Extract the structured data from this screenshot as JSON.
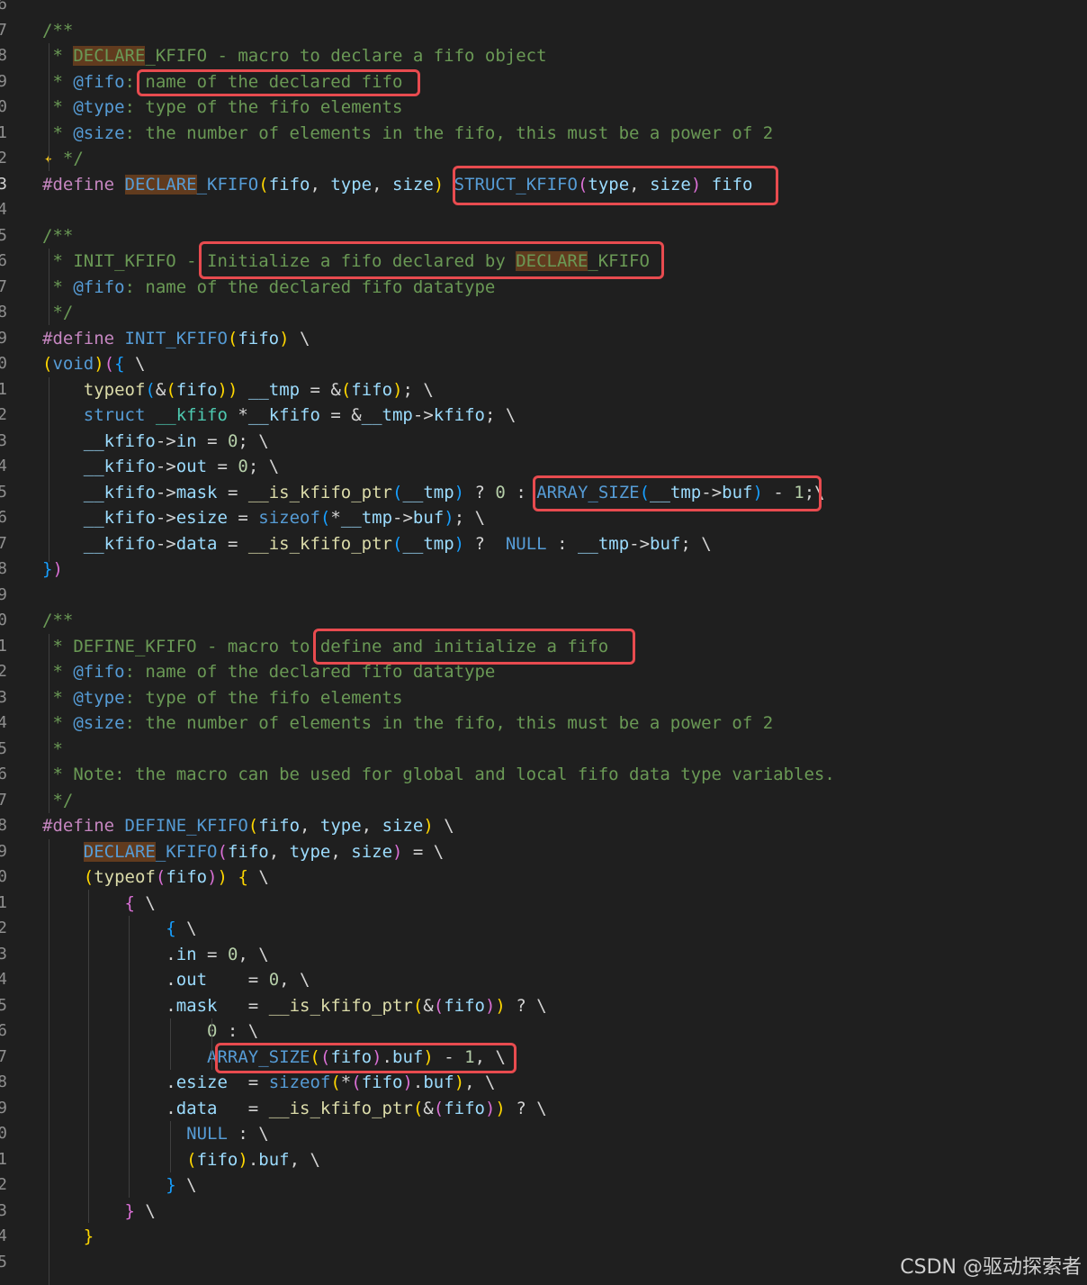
{
  "gutter": [
    "6",
    "7",
    "8",
    "9",
    "0",
    "1",
    "2",
    "3",
    "4",
    "5",
    "6",
    "7",
    "8",
    "9",
    "0",
    "1",
    "2",
    "3",
    "4",
    "5",
    "6",
    "7",
    "8",
    "9",
    "0",
    "1",
    "2",
    "3",
    "4",
    "5",
    "6",
    "7",
    "8",
    "9",
    "0",
    "1",
    "2",
    "3",
    "4",
    "5",
    "6",
    "7",
    "8",
    "9",
    "0",
    "1",
    "2",
    "3",
    "4",
    "5"
  ],
  "active_line": 7,
  "lines": [
    [],
    [
      [
        "c",
        "/**"
      ]
    ],
    [
      [
        "c",
        " * "
      ],
      [
        "cbg",
        "DECLARE"
      ],
      [
        "c",
        "_KFIFO - macro to declare a fifo object"
      ]
    ],
    [
      [
        "c",
        " * "
      ],
      [
        "cdoc",
        "@fifo"
      ],
      [
        "c",
        ": name of the declared fifo"
      ]
    ],
    [
      [
        "c",
        " * "
      ],
      [
        "cdoc",
        "@type"
      ],
      [
        "c",
        ": type of the fifo elements"
      ]
    ],
    [
      [
        "c",
        " * "
      ],
      [
        "cdoc",
        "@size"
      ],
      [
        "c",
        ": the number of elements in the fifo, this must be a power of 2"
      ]
    ],
    [
      [
        "c",
        "  */"
      ]
    ],
    [
      [
        "pp",
        "#define "
      ],
      [
        "mbg",
        "DECLARE"
      ],
      [
        "m",
        "_KFIFO"
      ],
      [
        "y",
        "("
      ],
      [
        "p",
        "fifo"
      ],
      [
        "t",
        ", "
      ],
      [
        "p",
        "type"
      ],
      [
        "t",
        ", "
      ],
      [
        "p",
        "size"
      ],
      [
        "y",
        ")"
      ],
      [
        "t",
        " "
      ],
      [
        "m",
        "STRUCT_KFIFO"
      ],
      [
        "pk",
        "("
      ],
      [
        "p",
        "type"
      ],
      [
        "t",
        ", "
      ],
      [
        "p",
        "size"
      ],
      [
        "pk",
        ")"
      ],
      [
        "t",
        " "
      ],
      [
        "p",
        "fifo"
      ]
    ],
    [],
    [
      [
        "c",
        "/**"
      ]
    ],
    [
      [
        "c",
        " * INIT_KFIFO - Initialize a fifo declared by "
      ],
      [
        "cbg",
        "DECLARE"
      ],
      [
        "c",
        "_KFIFO"
      ]
    ],
    [
      [
        "c",
        " * "
      ],
      [
        "cdoc",
        "@fifo"
      ],
      [
        "c",
        ": name of the declared fifo datatype"
      ]
    ],
    [
      [
        "c",
        " */"
      ]
    ],
    [
      [
        "pp",
        "#define "
      ],
      [
        "m",
        "INIT_KFIFO"
      ],
      [
        "y",
        "("
      ],
      [
        "p",
        "fifo"
      ],
      [
        "y",
        ")"
      ],
      [
        "t",
        " \\"
      ]
    ],
    [
      [
        "y",
        "("
      ],
      [
        "k",
        "void"
      ],
      [
        "y",
        ")"
      ],
      [
        "pk",
        "("
      ],
      [
        "bl",
        "{"
      ],
      [
        "t",
        " \\"
      ]
    ],
    [
      [
        "t",
        "    "
      ],
      [
        "f",
        "typeof"
      ],
      [
        "bl",
        "("
      ],
      [
        "t",
        "&"
      ],
      [
        "y",
        "("
      ],
      [
        "v",
        "fifo"
      ],
      [
        "y",
        "))"
      ],
      [
        "t",
        " "
      ],
      [
        "v",
        "__tmp"
      ],
      [
        "t",
        " = &"
      ],
      [
        "y",
        "("
      ],
      [
        "v",
        "fifo"
      ],
      [
        "y",
        ")"
      ],
      [
        "t",
        "; \\"
      ]
    ],
    [
      [
        "t",
        "    "
      ],
      [
        "k",
        "struct"
      ],
      [
        "t",
        " "
      ],
      [
        "s",
        "__kfifo"
      ],
      [
        "t",
        " *"
      ],
      [
        "v",
        "__kfifo"
      ],
      [
        "t",
        " = &"
      ],
      [
        "v",
        "__tmp"
      ],
      [
        "t",
        "->"
      ],
      [
        "v",
        "kfifo"
      ],
      [
        "t",
        "; \\"
      ]
    ],
    [
      [
        "t",
        "    "
      ],
      [
        "v",
        "__kfifo"
      ],
      [
        "t",
        "->"
      ],
      [
        "v",
        "in"
      ],
      [
        "t",
        " = "
      ],
      [
        "n",
        "0"
      ],
      [
        "t",
        "; \\"
      ]
    ],
    [
      [
        "t",
        "    "
      ],
      [
        "v",
        "__kfifo"
      ],
      [
        "t",
        "->"
      ],
      [
        "v",
        "out"
      ],
      [
        "t",
        " = "
      ],
      [
        "n",
        "0"
      ],
      [
        "t",
        "; \\"
      ]
    ],
    [
      [
        "t",
        "    "
      ],
      [
        "v",
        "__kfifo"
      ],
      [
        "t",
        "->"
      ],
      [
        "v",
        "mask"
      ],
      [
        "t",
        " = "
      ],
      [
        "f",
        "__is_kfifo_ptr"
      ],
      [
        "bl",
        "("
      ],
      [
        "v",
        "__tmp"
      ],
      [
        "bl",
        ")"
      ],
      [
        "t",
        " ? "
      ],
      [
        "n",
        "0"
      ],
      [
        "t",
        " : "
      ],
      [
        "m",
        "ARRAY_SIZE"
      ],
      [
        "bl",
        "("
      ],
      [
        "v",
        "__tmp"
      ],
      [
        "t",
        "->"
      ],
      [
        "v",
        "buf"
      ],
      [
        "bl",
        ")"
      ],
      [
        "t",
        " - "
      ],
      [
        "n",
        "1"
      ],
      [
        "t",
        ";\\"
      ]
    ],
    [
      [
        "t",
        "    "
      ],
      [
        "v",
        "__kfifo"
      ],
      [
        "t",
        "->"
      ],
      [
        "v",
        "esize"
      ],
      [
        "t",
        " = "
      ],
      [
        "k",
        "sizeof"
      ],
      [
        "bl",
        "("
      ],
      [
        "t",
        "*"
      ],
      [
        "v",
        "__tmp"
      ],
      [
        "t",
        "->"
      ],
      [
        "v",
        "buf"
      ],
      [
        "bl",
        ")"
      ],
      [
        "t",
        "; \\"
      ]
    ],
    [
      [
        "t",
        "    "
      ],
      [
        "v",
        "__kfifo"
      ],
      [
        "t",
        "->"
      ],
      [
        "v",
        "data"
      ],
      [
        "t",
        " = "
      ],
      [
        "f",
        "__is_kfifo_ptr"
      ],
      [
        "bl",
        "("
      ],
      [
        "v",
        "__tmp"
      ],
      [
        "bl",
        ")"
      ],
      [
        "t",
        " ?  "
      ],
      [
        "k",
        "NULL"
      ],
      [
        "t",
        " : "
      ],
      [
        "v",
        "__tmp"
      ],
      [
        "t",
        "->"
      ],
      [
        "v",
        "buf"
      ],
      [
        "t",
        "; \\"
      ]
    ],
    [
      [
        "bl",
        "}"
      ],
      [
        "pk",
        ")"
      ]
    ],
    [],
    [
      [
        "c",
        "/**"
      ]
    ],
    [
      [
        "c",
        " * DEFINE_KFIFO - macro to define and initialize a fifo"
      ]
    ],
    [
      [
        "c",
        " * "
      ],
      [
        "cdoc",
        "@fifo"
      ],
      [
        "c",
        ": name of the declared fifo datatype"
      ]
    ],
    [
      [
        "c",
        " * "
      ],
      [
        "cdoc",
        "@type"
      ],
      [
        "c",
        ": type of the fifo elements"
      ]
    ],
    [
      [
        "c",
        " * "
      ],
      [
        "cdoc",
        "@size"
      ],
      [
        "c",
        ": the number of elements in the fifo, this must be a power of 2"
      ]
    ],
    [
      [
        "c",
        " *"
      ]
    ],
    [
      [
        "c",
        " * Note: the macro can be used for global and local fifo data type variables."
      ]
    ],
    [
      [
        "c",
        " */"
      ]
    ],
    [
      [
        "pp",
        "#define "
      ],
      [
        "m",
        "DEFINE_KFIFO"
      ],
      [
        "y",
        "("
      ],
      [
        "p",
        "fifo"
      ],
      [
        "t",
        ", "
      ],
      [
        "p",
        "type"
      ],
      [
        "t",
        ", "
      ],
      [
        "p",
        "size"
      ],
      [
        "y",
        ")"
      ],
      [
        "t",
        " \\"
      ]
    ],
    [
      [
        "t",
        "    "
      ],
      [
        "mbg",
        "DECLARE"
      ],
      [
        "m",
        "_KFIFO"
      ],
      [
        "pk",
        "("
      ],
      [
        "p",
        "fifo"
      ],
      [
        "t",
        ", "
      ],
      [
        "p",
        "type"
      ],
      [
        "t",
        ", "
      ],
      [
        "p",
        "size"
      ],
      [
        "pk",
        ")"
      ],
      [
        "t",
        " = \\"
      ]
    ],
    [
      [
        "t",
        "    "
      ],
      [
        "y",
        "("
      ],
      [
        "f",
        "typeof"
      ],
      [
        "pk",
        "("
      ],
      [
        "p",
        "fifo"
      ],
      [
        "pk",
        ")"
      ],
      [
        "y",
        ")"
      ],
      [
        "t",
        " "
      ],
      [
        "y",
        "{"
      ],
      [
        "t",
        " \\"
      ]
    ],
    [
      [
        "t",
        "        "
      ],
      [
        "pk",
        "{"
      ],
      [
        "t",
        " \\"
      ]
    ],
    [
      [
        "t",
        "            "
      ],
      [
        "bl",
        "{"
      ],
      [
        "t",
        " \\"
      ]
    ],
    [
      [
        "t",
        "            ."
      ],
      [
        "v",
        "in"
      ],
      [
        "t",
        " = "
      ],
      [
        "n",
        "0"
      ],
      [
        "t",
        ", \\"
      ]
    ],
    [
      [
        "t",
        "            ."
      ],
      [
        "v",
        "out"
      ],
      [
        "t",
        "    = "
      ],
      [
        "n",
        "0"
      ],
      [
        "t",
        ", \\"
      ]
    ],
    [
      [
        "t",
        "            ."
      ],
      [
        "v",
        "mask"
      ],
      [
        "t",
        "   = "
      ],
      [
        "f",
        "__is_kfifo_ptr"
      ],
      [
        "y",
        "("
      ],
      [
        "t",
        "&"
      ],
      [
        "pk",
        "("
      ],
      [
        "p",
        "fifo"
      ],
      [
        "pk",
        ")"
      ],
      [
        "y",
        ")"
      ],
      [
        "t",
        " ? \\"
      ]
    ],
    [
      [
        "t",
        "                "
      ],
      [
        "n",
        "0"
      ],
      [
        "t",
        " : \\"
      ]
    ],
    [
      [
        "t",
        "                "
      ],
      [
        "m",
        "ARRAY_SIZE"
      ],
      [
        "y",
        "("
      ],
      [
        "pk",
        "("
      ],
      [
        "p",
        "fifo"
      ],
      [
        "pk",
        ")"
      ],
      [
        "t",
        "."
      ],
      [
        "v",
        "buf"
      ],
      [
        "y",
        ")"
      ],
      [
        "t",
        " - "
      ],
      [
        "n",
        "1"
      ],
      [
        "t",
        ", \\"
      ]
    ],
    [
      [
        "t",
        "            ."
      ],
      [
        "v",
        "esize"
      ],
      [
        "t",
        "  = "
      ],
      [
        "k",
        "sizeof"
      ],
      [
        "y",
        "("
      ],
      [
        "t",
        "*"
      ],
      [
        "pk",
        "("
      ],
      [
        "p",
        "fifo"
      ],
      [
        "pk",
        ")"
      ],
      [
        "t",
        "."
      ],
      [
        "v",
        "buf"
      ],
      [
        "y",
        ")"
      ],
      [
        "t",
        ", \\"
      ]
    ],
    [
      [
        "t",
        "            ."
      ],
      [
        "v",
        "data"
      ],
      [
        "t",
        "   = "
      ],
      [
        "f",
        "__is_kfifo_ptr"
      ],
      [
        "y",
        "("
      ],
      [
        "t",
        "&"
      ],
      [
        "pk",
        "("
      ],
      [
        "p",
        "fifo"
      ],
      [
        "pk",
        ")"
      ],
      [
        "y",
        ")"
      ],
      [
        "t",
        " ? \\"
      ]
    ],
    [
      [
        "t",
        "              "
      ],
      [
        "k",
        "NULL"
      ],
      [
        "t",
        " : \\"
      ]
    ],
    [
      [
        "t",
        "              "
      ],
      [
        "y",
        "("
      ],
      [
        "p",
        "fifo"
      ],
      [
        "y",
        ")"
      ],
      [
        "t",
        "."
      ],
      [
        "v",
        "buf"
      ],
      [
        "t",
        ", \\"
      ]
    ],
    [
      [
        "t",
        "            "
      ],
      [
        "bl",
        "}"
      ],
      [
        "t",
        " \\"
      ]
    ],
    [
      [
        "t",
        "        "
      ],
      [
        "pk",
        "}"
      ],
      [
        "t",
        " \\"
      ]
    ],
    [
      [
        "t",
        "    "
      ],
      [
        "y",
        "}"
      ]
    ],
    []
  ],
  "watermark": "CSDN @驱动探索者",
  "colors": {
    "background": "#1f1f1f",
    "comment": "#6a9955",
    "highlight_box": "#e84b4f",
    "macro": "#569cd6",
    "param": "#9cdcfe"
  }
}
